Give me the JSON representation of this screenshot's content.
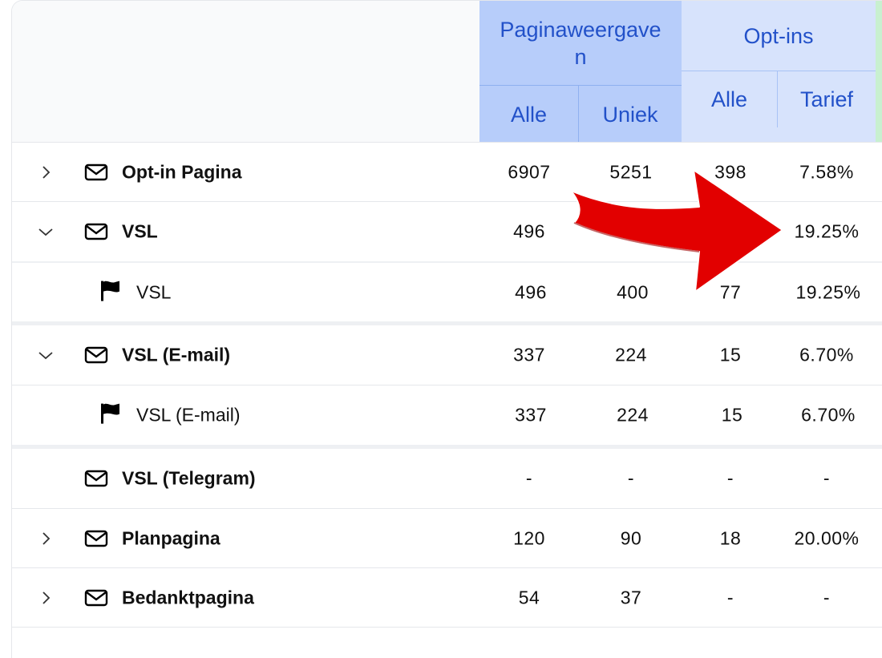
{
  "header": {
    "group1_title": "Paginaweergaven",
    "group1_col1": "Alle",
    "group1_col2": "Uniek",
    "group2_title": "Opt-ins",
    "group2_col1": "Alle",
    "group2_col2": "Tarief"
  },
  "rows": [
    {
      "type": "page",
      "expand": "collapsed",
      "icon": "envelope-icon",
      "name": "Opt-in Pagina",
      "pv_all": "6907",
      "pv_unique": "5251",
      "optin_all": "398",
      "optin_rate": "7.58%"
    },
    {
      "type": "page",
      "expand": "expanded",
      "icon": "envelope-icon",
      "name": "VSL",
      "pv_all": "496",
      "pv_unique": "",
      "optin_all": "",
      "optin_rate": "19.25%"
    },
    {
      "type": "variant",
      "icon": "flag-icon",
      "name": "VSL",
      "pv_all": "496",
      "pv_unique": "400",
      "optin_all": "77",
      "optin_rate": "19.25%"
    },
    {
      "type": "page",
      "expand": "expanded",
      "icon": "envelope-icon",
      "name": "VSL (E-mail)",
      "pv_all": "337",
      "pv_unique": "224",
      "optin_all": "15",
      "optin_rate": "6.70%"
    },
    {
      "type": "variant",
      "icon": "flag-icon",
      "name": "VSL (E-mail)",
      "pv_all": "337",
      "pv_unique": "224",
      "optin_all": "15",
      "optin_rate": "6.70%"
    },
    {
      "type": "page",
      "expand": "none",
      "icon": "envelope-icon",
      "name": "VSL (Telegram)",
      "pv_all": "-",
      "pv_unique": "-",
      "optin_all": "-",
      "optin_rate": "-"
    },
    {
      "type": "page",
      "expand": "collapsed",
      "icon": "envelope-icon",
      "name": "Planpagina",
      "pv_all": "120",
      "pv_unique": "90",
      "optin_all": "18",
      "optin_rate": "20.00%"
    },
    {
      "type": "page",
      "expand": "collapsed",
      "icon": "envelope-icon",
      "name": "Bedanktpagina",
      "pv_all": "54",
      "pv_unique": "37",
      "optin_all": "-",
      "optin_rate": "-"
    }
  ],
  "annotation": {
    "icon": "red-arrow-icon",
    "color": "#e00000"
  }
}
